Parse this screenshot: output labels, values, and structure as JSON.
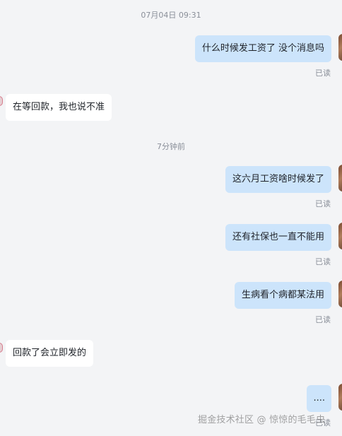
{
  "timestamps": {
    "first": "07月04日 09:31",
    "second": "7分钟前"
  },
  "messages": [
    {
      "id": "m1",
      "side": "out",
      "text": "什么时候发工资了 没个消息吗",
      "status": "已读"
    },
    {
      "id": "m2",
      "side": "in",
      "text": "在等回款，我也说不准"
    },
    {
      "id": "m3",
      "side": "out",
      "text": "这六月工资啥时候发了",
      "status": "已读"
    },
    {
      "id": "m4",
      "side": "out",
      "text": "还有社保也一直不能用",
      "status": "已读"
    },
    {
      "id": "m5",
      "side": "out",
      "text": "生病看个病都某法用",
      "status": "已读"
    },
    {
      "id": "m6",
      "side": "in",
      "text": "回款了会立即发的"
    },
    {
      "id": "m7",
      "side": "out",
      "text": "....",
      "status": "已读"
    }
  ],
  "watermark": "掘金技术社区 @ 惊惊的毛毛虫"
}
